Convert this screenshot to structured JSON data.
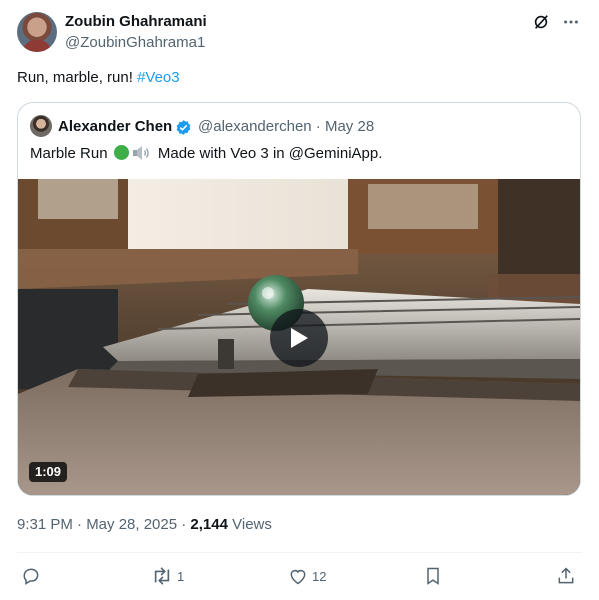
{
  "author": {
    "name": "Zoubin Ghahramani",
    "handle": "@ZoubinGhahrama1"
  },
  "tweet": {
    "text_prefix": "Run, marble, run! ",
    "hashtag": "#Veo3"
  },
  "quote": {
    "name": "Alexander Chen",
    "meta": "@alexanderchen · May 28",
    "text_before": "Marble Run ",
    "text_after": " Made with Veo 3 in @GeminiApp.",
    "video_duration": "1:09"
  },
  "timestamp": {
    "time_date": "9:31 PM · May 28, 2025 · ",
    "views_count": "2,144",
    "views_label": " Views"
  },
  "actions": {
    "reply_count": "",
    "retweet_count": "1",
    "like_count": "12"
  },
  "colors": {
    "accent": "#1d9bf0",
    "muted": "#536471",
    "verified": "#1d9bf0"
  }
}
